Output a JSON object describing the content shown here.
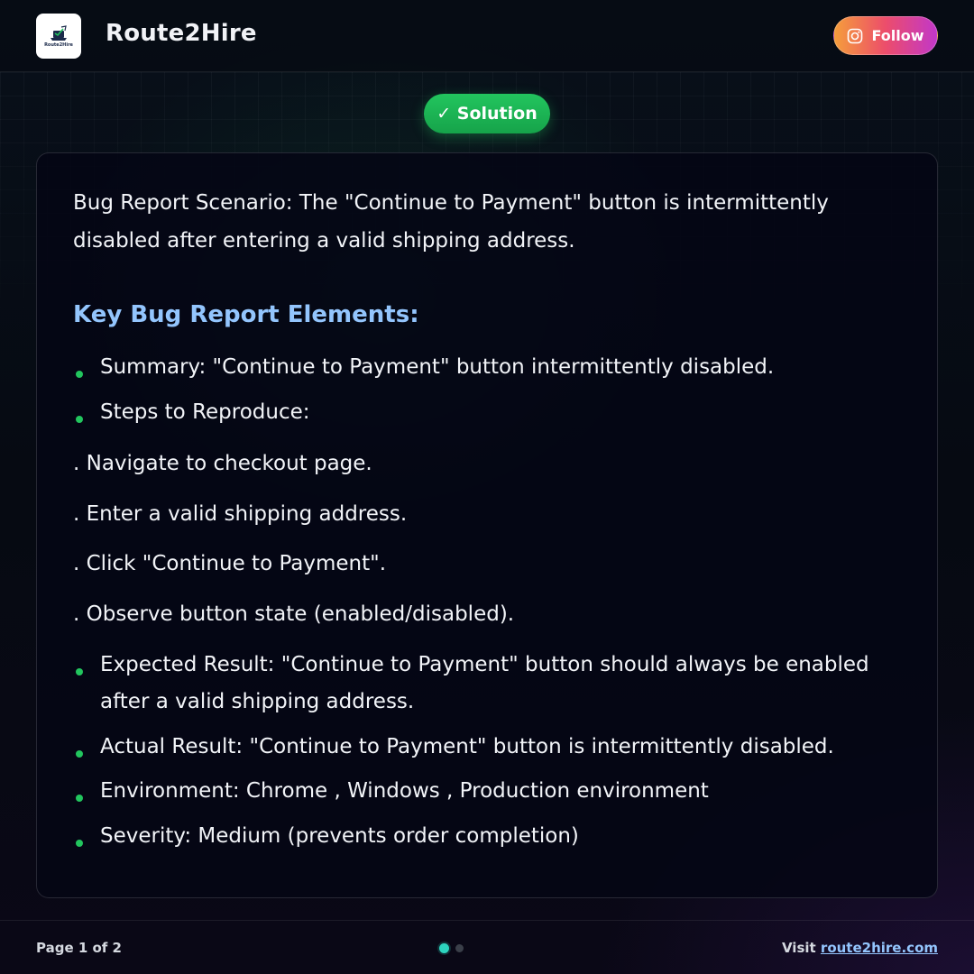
{
  "header": {
    "logo_text": "Route2Hire",
    "brand": "Route2Hire",
    "follow_label": "Follow"
  },
  "badge": {
    "label": "✓ Solution"
  },
  "card": {
    "intro": "Bug Report Scenario: The \"Continue to Payment\" button is intermittently disabled after entering a valid shipping address.",
    "section_title": "Key Bug Report Elements:",
    "items": [
      {
        "type": "bullet",
        "text": "Summary: \"Continue to Payment\" button intermittently disabled."
      },
      {
        "type": "bullet",
        "text": "Steps to Reproduce:"
      },
      {
        "type": "step",
        "text": ". Navigate to checkout page."
      },
      {
        "type": "step",
        "text": ". Enter a valid shipping address."
      },
      {
        "type": "step",
        "text": ". Click \"Continue to Payment\"."
      },
      {
        "type": "step",
        "text": ". Observe button state (enabled/disabled)."
      },
      {
        "type": "bullet",
        "text": "Expected Result: \"Continue to Payment\" button should always be enabled after a valid shipping address."
      },
      {
        "type": "bullet",
        "text": "Actual Result: \"Continue to Payment\" button is intermittently disabled."
      },
      {
        "type": "bullet",
        "text": "Environment: Chrome , Windows , Production environment"
      },
      {
        "type": "bullet",
        "text": "Severity: Medium (prevents order completion)"
      }
    ]
  },
  "footer": {
    "page_indicator": "Page 1 of 2",
    "current_page": 1,
    "total_pages": 2,
    "visit_prefix": "Visit",
    "visit_link": "route2hire.com"
  },
  "colors": {
    "accent_green": "#22c55e",
    "heading_blue": "#93c5fd",
    "follow_gradient": [
      "#f59e3b",
      "#ec4d6b",
      "#c237c9"
    ]
  },
  "icons": {
    "logo": "route2hire-logo-icon",
    "follow": "instagram-icon"
  }
}
